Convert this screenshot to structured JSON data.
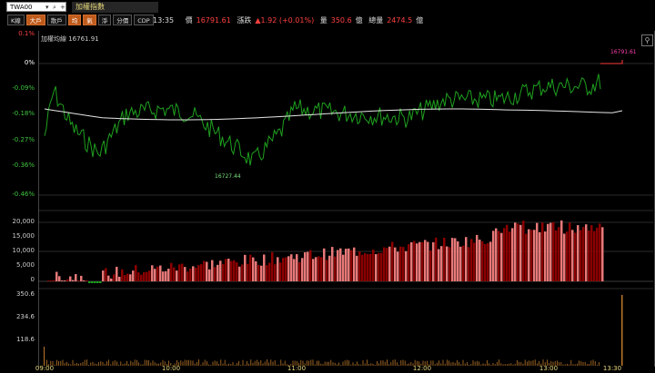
{
  "toolbar": {
    "symbol": "TWA00",
    "title": "加權指數",
    "buttons": [
      {
        "label": "K線",
        "active": false
      },
      {
        "label": "大戶",
        "active": true
      },
      {
        "label": "散戶",
        "active": false
      },
      {
        "label": "均",
        "active": true
      },
      {
        "label": "氣",
        "active": true
      },
      {
        "label": "淨",
        "active": false
      },
      {
        "label": "分價",
        "active": false
      },
      {
        "label": "CDP",
        "active": false
      }
    ]
  },
  "quote": {
    "time": "13:35",
    "price_label": "價",
    "price": "16791.61",
    "change_label": "漲跌",
    "change": "▲1.92 (+0.01%)",
    "volume_label": "量",
    "volume": "350.6",
    "unit": "億",
    "total_label": "總量",
    "total": "2474.5"
  },
  "chart": {
    "avg_label": "加權均線 16761.91",
    "high_marker": "16791.61",
    "low_marker": "16727.44",
    "pct_ticks": [
      "0.1%",
      "0%",
      "-0.09%",
      "-0.18%",
      "-0.27%",
      "-0.36%",
      "-0.46%"
    ],
    "mid_ticks": [
      "20,000",
      "15,000",
      "10,000",
      "5,000",
      "0"
    ],
    "vol_ticks": [
      "350.6",
      "234.6",
      "118.6"
    ],
    "time_ticks": [
      "09:00",
      "10:00",
      "11:00",
      "12:00",
      "13:00",
      "13:30"
    ],
    "colors": {
      "up": "#ff3b3b",
      "down": "#1fa01f",
      "avg": "#e6e6e6",
      "bar_dark": "#8b0000",
      "bar_light": "#e87878",
      "vol": "#b8762b"
    }
  }
}
